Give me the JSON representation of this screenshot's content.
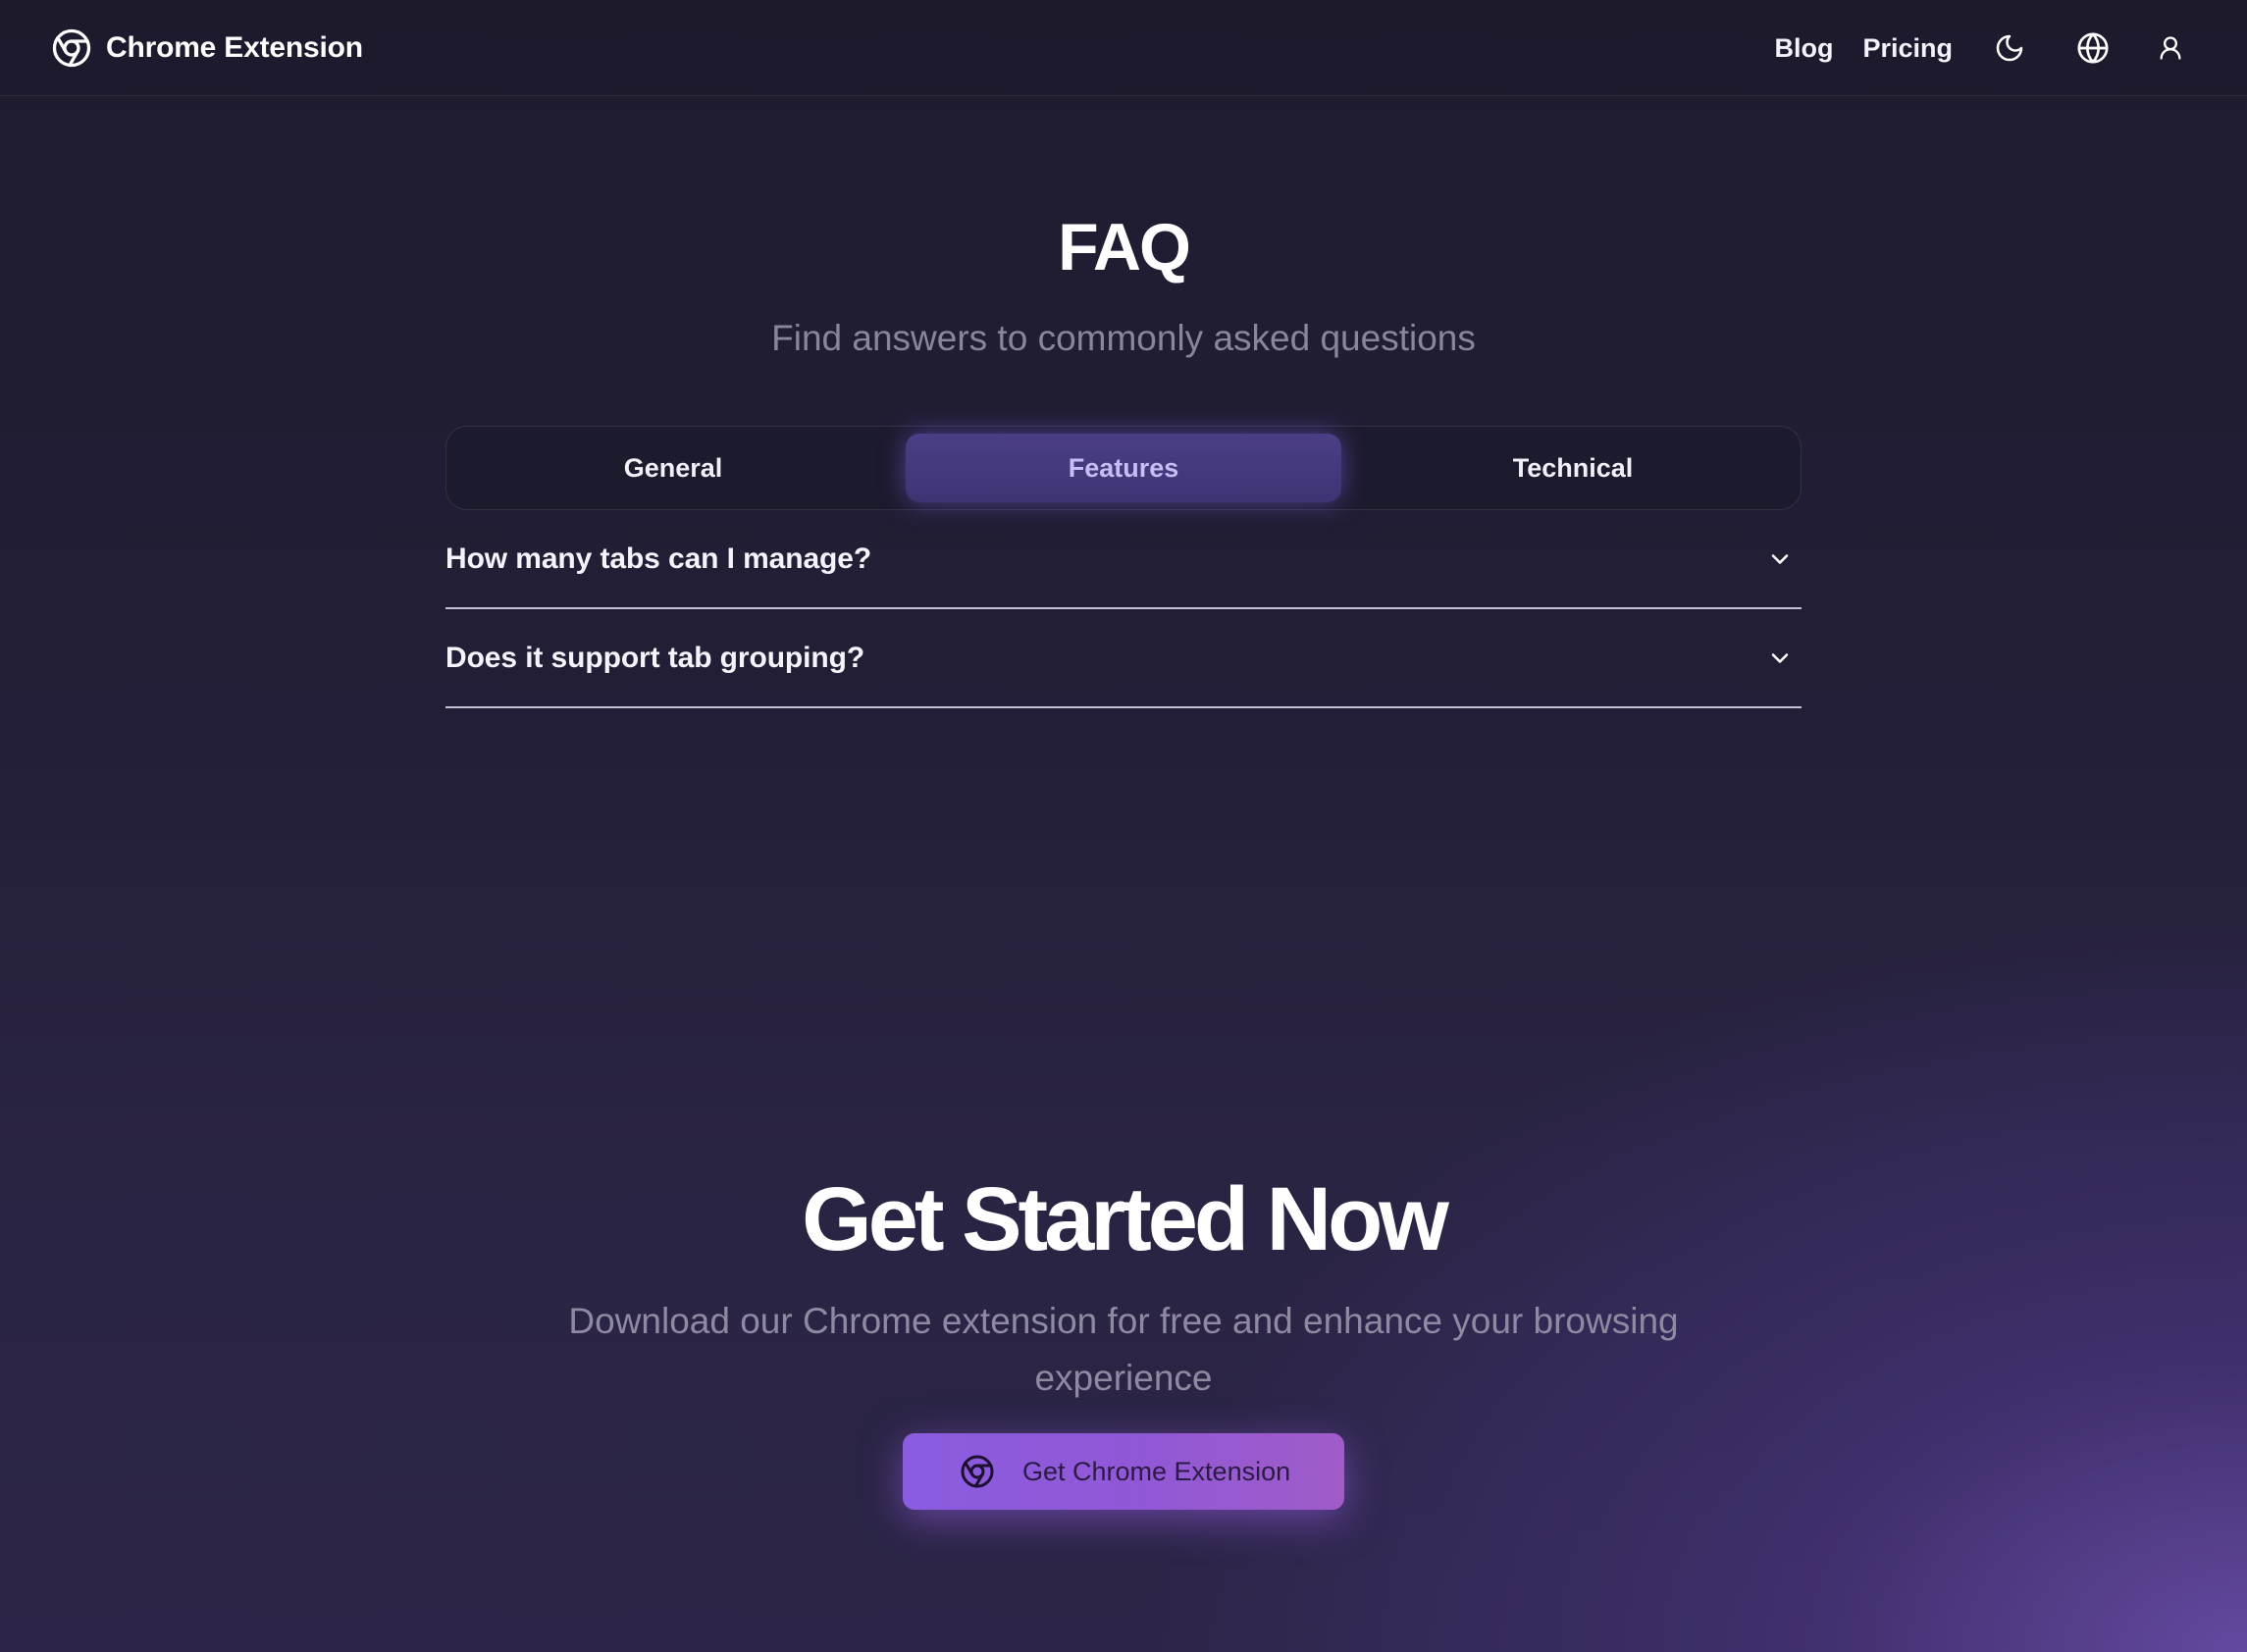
{
  "header": {
    "brand_name": "Chrome Extension",
    "nav": {
      "blog_label": "Blog",
      "pricing_label": "Pricing"
    },
    "icons": [
      "chrome-logo-icon",
      "moon-icon",
      "globe-icon",
      "user-icon"
    ]
  },
  "faq": {
    "title": "FAQ",
    "subtitle": "Find answers to commonly asked questions",
    "tabs": [
      {
        "label": "General"
      },
      {
        "label": "Features",
        "active": true
      },
      {
        "label": "Technical"
      }
    ],
    "items": [
      {
        "question": "How many tabs can I manage?"
      },
      {
        "question": "Does it support tab grouping?"
      }
    ]
  },
  "cta": {
    "title": "Get Started Now",
    "subtitle": "Download our Chrome extension for free and enhance your browsing experience",
    "button_label": "Get Chrome Extension"
  },
  "colors": {
    "background": "#221e36",
    "accent": "#8a5ce0",
    "active_tab": "#4b3e86",
    "muted_text": "#8a8599"
  }
}
